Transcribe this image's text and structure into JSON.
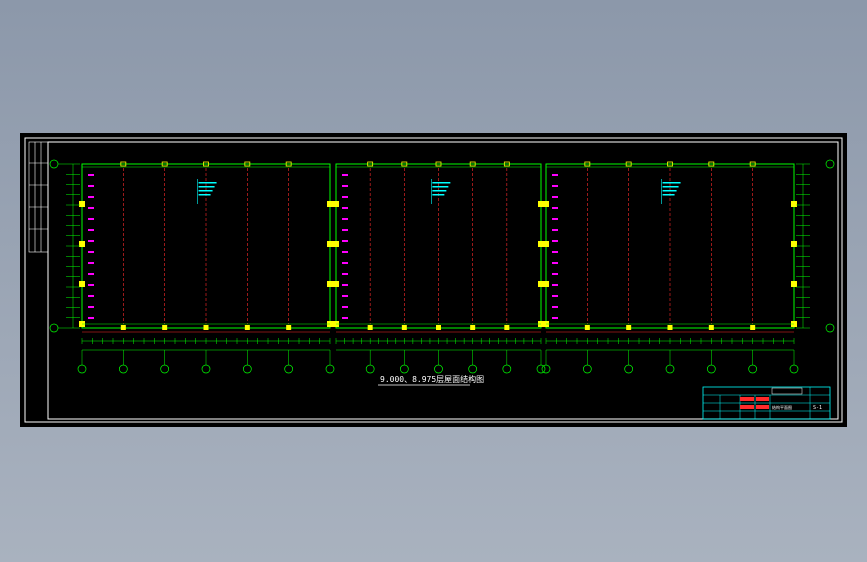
{
  "drawing": {
    "title": "9.000、8.975层屋面结构图",
    "axis_numbers": [
      "1",
      "2",
      "3",
      "4",
      "5",
      "6",
      "7",
      "8",
      "9",
      "10",
      "11",
      "12",
      "13",
      "14",
      "15",
      "16",
      "17",
      "18",
      "19",
      "20"
    ],
    "axis_letters": [
      "A",
      "B"
    ],
    "dimension_total": "7200",
    "elevation_tags": [
      "Q1",
      "Q2"
    ],
    "title_block": {
      "project": "结构平面图",
      "drawing_no": "S-1"
    }
  },
  "colors": {
    "background": "#000000",
    "frame": "#ffffff",
    "grid": "#ff2a2a",
    "dimension": "#00ff00",
    "column": "#ffff00",
    "annotation": "#00ffff",
    "tag": "#ff00ff"
  }
}
